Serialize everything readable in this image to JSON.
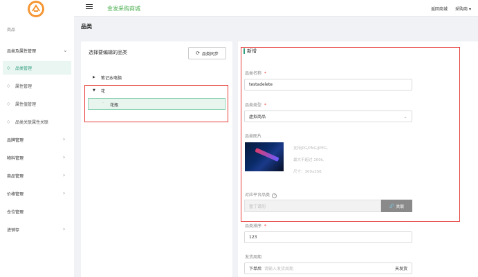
{
  "sidebar": {
    "home_label": "商品",
    "menu": [
      {
        "label": "品类及属性管理"
      },
      {
        "label": "品牌管理"
      },
      {
        "label": "物料管理"
      },
      {
        "label": "商品管理"
      },
      {
        "label": "价格管理"
      },
      {
        "label": "仓位管理"
      },
      {
        "label": "进销存"
      }
    ],
    "sub_items": [
      {
        "label": "品类管理",
        "active": true
      },
      {
        "label": "属性管理"
      },
      {
        "label": "属性值管理"
      },
      {
        "label": "品类关联属性关联"
      }
    ]
  },
  "header": {
    "site_name": "金发采购商城",
    "back_label": "返回商城",
    "user_label": "采购商"
  },
  "page": {
    "title": "品类"
  },
  "left_panel": {
    "title": "选择要编辑的品类",
    "sync_label": "品类同步",
    "tree": [
      {
        "label": "笔记本电脑",
        "expanded": false
      },
      {
        "label": "花",
        "expanded": true
      },
      {
        "label": "花瓶",
        "selected": true
      }
    ]
  },
  "form": {
    "title": "新增",
    "name": {
      "label": "品类名称",
      "value": "testadelete"
    },
    "type": {
      "label": "品类类型",
      "value": "虚拟商品"
    },
    "image": {
      "label": "品类图片",
      "hints": [
        "支持JPG/PNG/JPEG,",
        "最大不超过 200k,",
        "尺寸：300x256"
      ]
    },
    "platform": {
      "label": "对应平台品类",
      "placeholder": "暂丁请勿",
      "button": "关联"
    },
    "sort": {
      "label": "品类排序",
      "value": "123"
    },
    "ship": {
      "label": "发货周期",
      "prefix": "下单后",
      "placeholder": "请输入发货周期",
      "suffix": "天发货"
    }
  },
  "colors": {
    "accent": "#34a080",
    "required": "#e53935",
    "highlight_box": "#e53935"
  }
}
